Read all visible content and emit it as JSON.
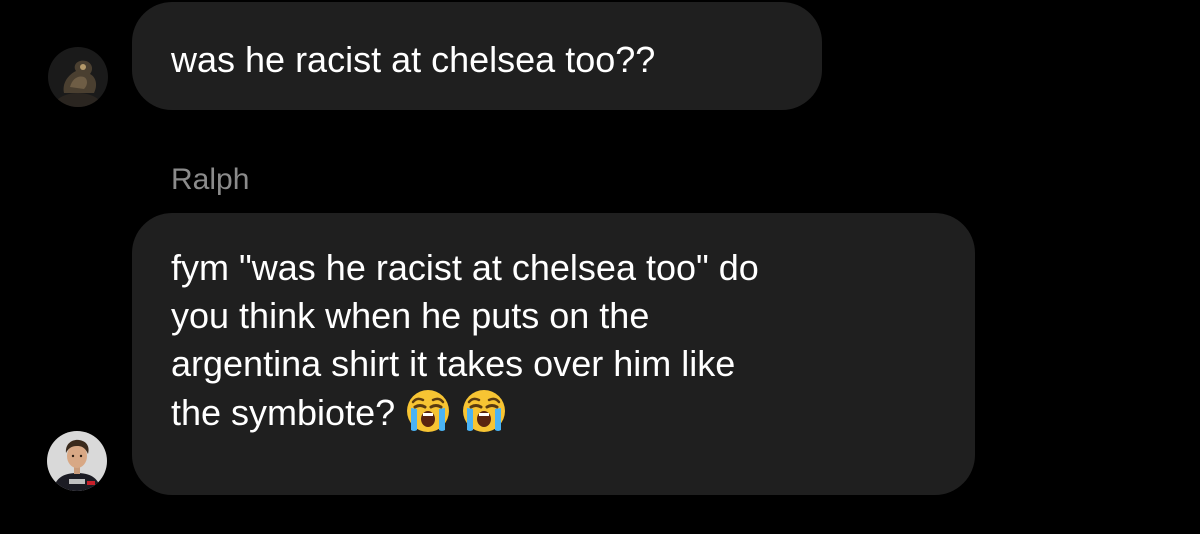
{
  "conversation": {
    "messages": [
      {
        "sender": "",
        "avatar_icon": "dark-creature-avatar",
        "text": "was he racist at chelsea too??"
      },
      {
        "sender": "Ralph",
        "avatar_icon": "person-portrait-avatar",
        "lines": [
          "fym \"was he racist at chelsea too\" do",
          "you think when he puts on the",
          "argentina shirt it takes over him like",
          "the symbiote?"
        ],
        "emojis": [
          "loudly-crying-face-emoji",
          "loudly-crying-face-emoji"
        ]
      }
    ]
  },
  "colors": {
    "background": "#000000",
    "bubble": "#1f1f1f",
    "text": "#ffffff",
    "sender_name": "#8b8b8b"
  }
}
